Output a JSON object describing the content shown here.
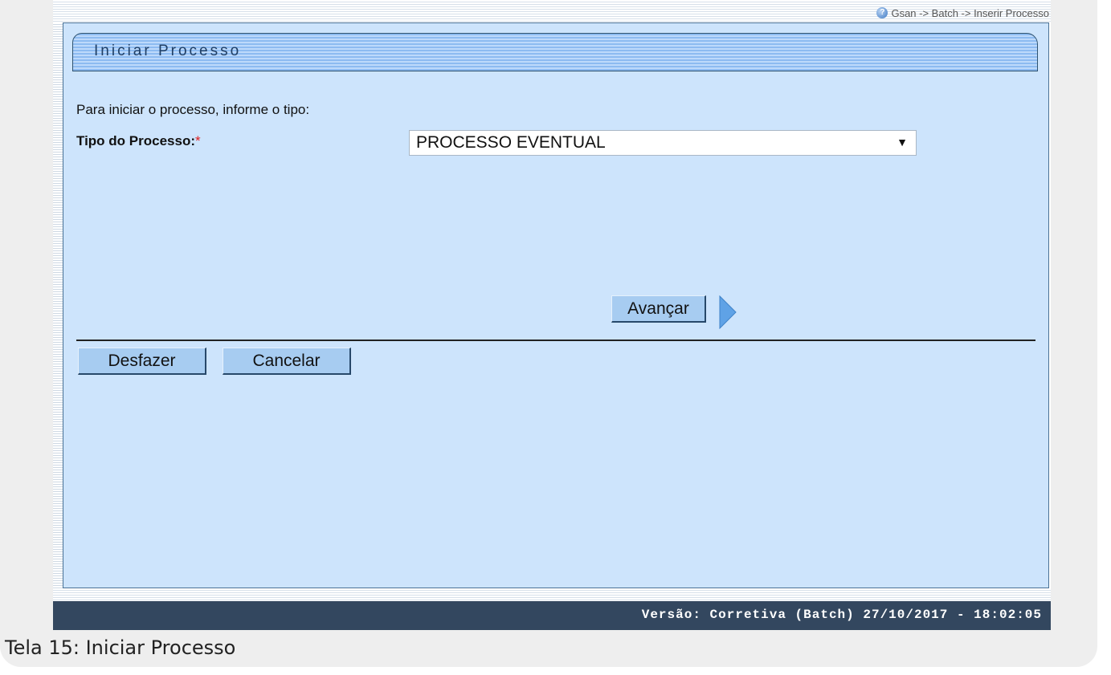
{
  "breadcrumb": {
    "text": "Gsan -> Batch -> Inserir Processo",
    "icon": "help-icon"
  },
  "panel": {
    "title": "Iniciar Processo"
  },
  "form": {
    "intro": "Para iniciar o processo, informe o tipo:",
    "tipo_label": "Tipo do Processo:",
    "required_mark": "*",
    "tipo_selected": "PROCESSO EVENTUAL"
  },
  "buttons": {
    "avancar": "Avançar",
    "desfazer": "Desfazer",
    "cancelar": "Cancelar"
  },
  "footer": {
    "version": "Versão: Corretiva (Batch) 27/10/2017 - 18:02:05"
  },
  "caption": "Tela 15: Iniciar Processo",
  "colors": {
    "panel_bg": "#cde4fc",
    "button_bg": "#a7ccf1",
    "footer_bg": "#33475f",
    "required": "#e02020"
  }
}
